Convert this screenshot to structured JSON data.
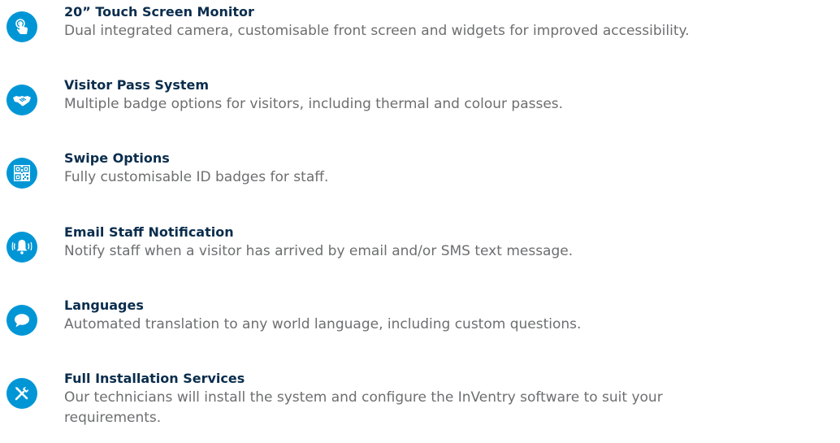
{
  "brand_color": "#0096d6",
  "features": [
    {
      "icon": "touch-hand-icon",
      "title": "20” Touch Screen Monitor",
      "description": "Dual integrated camera, customisable front screen and widgets for improved accessibility."
    },
    {
      "icon": "handshake-icon",
      "title": "Visitor Pass System",
      "description": "Multiple badge options for visitors, including thermal and colour passes."
    },
    {
      "icon": "qr-code-icon",
      "title": "Swipe Options",
      "description": "Fully customisable ID badges for staff."
    },
    {
      "icon": "bell-icon",
      "title": "Email Staff Notification",
      "description": "Notify staff when a visitor has arrived by email and/or SMS text message."
    },
    {
      "icon": "speech-bubble-icon",
      "title": "Languages",
      "description": "Automated translation to any world language, including custom questions."
    },
    {
      "icon": "tools-icon",
      "title": "Full Installation Services",
      "description": "Our technicians will install the system and configure the InVentry software to suit your requirements."
    }
  ]
}
